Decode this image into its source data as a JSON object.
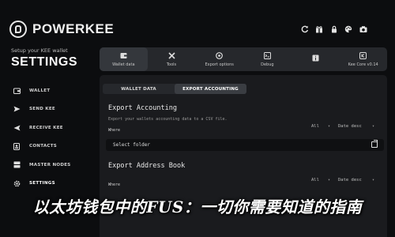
{
  "brand": {
    "name": "POWERKEE"
  },
  "sidebar": {
    "setup_subtitle": "Setup your KEE wallet",
    "title": "SETTINGS",
    "items": [
      {
        "label": "WALLET",
        "icon": "wallet-icon"
      },
      {
        "label": "SEND KEE",
        "icon": "send-icon"
      },
      {
        "label": "RECEIVE KEE",
        "icon": "receive-icon"
      },
      {
        "label": "CONTACTS",
        "icon": "contacts-icon"
      },
      {
        "label": "MASTER NODES",
        "icon": "master-nodes-icon"
      },
      {
        "label": "SETTINGS",
        "icon": "gear-icon",
        "active": true
      }
    ]
  },
  "top_icons": [
    "refresh-icon",
    "gift-icon",
    "lock-icon",
    "palette-icon",
    "camera-icon"
  ],
  "tabs": [
    {
      "label": "Wallet data",
      "icon": "wallet-data-icon",
      "active": true
    },
    {
      "label": "Tools",
      "icon": "tools-icon"
    },
    {
      "label": "Export options",
      "icon": "export-icon"
    },
    {
      "label": "Debug",
      "icon": "debug-icon"
    },
    {
      "label": "",
      "icon": "info-icon"
    },
    {
      "label": "Kee Core v0.14",
      "icon": "core-icon"
    }
  ],
  "subtabs": [
    {
      "label": "WALLET DATA"
    },
    {
      "label": "EXPORT ACCOUNTING",
      "active": true
    }
  ],
  "export_accounting": {
    "title": "Export Accounting",
    "description": "Export your wallets accounting data to a CSV file.",
    "filter": "All",
    "sort": "Date desc",
    "where_label": "Where",
    "folder_value": "Select folder"
  },
  "export_address_book": {
    "title": "Export Address Book",
    "filter": "All",
    "sort": "Date desc",
    "where_label": "Where"
  },
  "caption": "以太坊钱包中的FUS：一切你需要知道的指南"
}
